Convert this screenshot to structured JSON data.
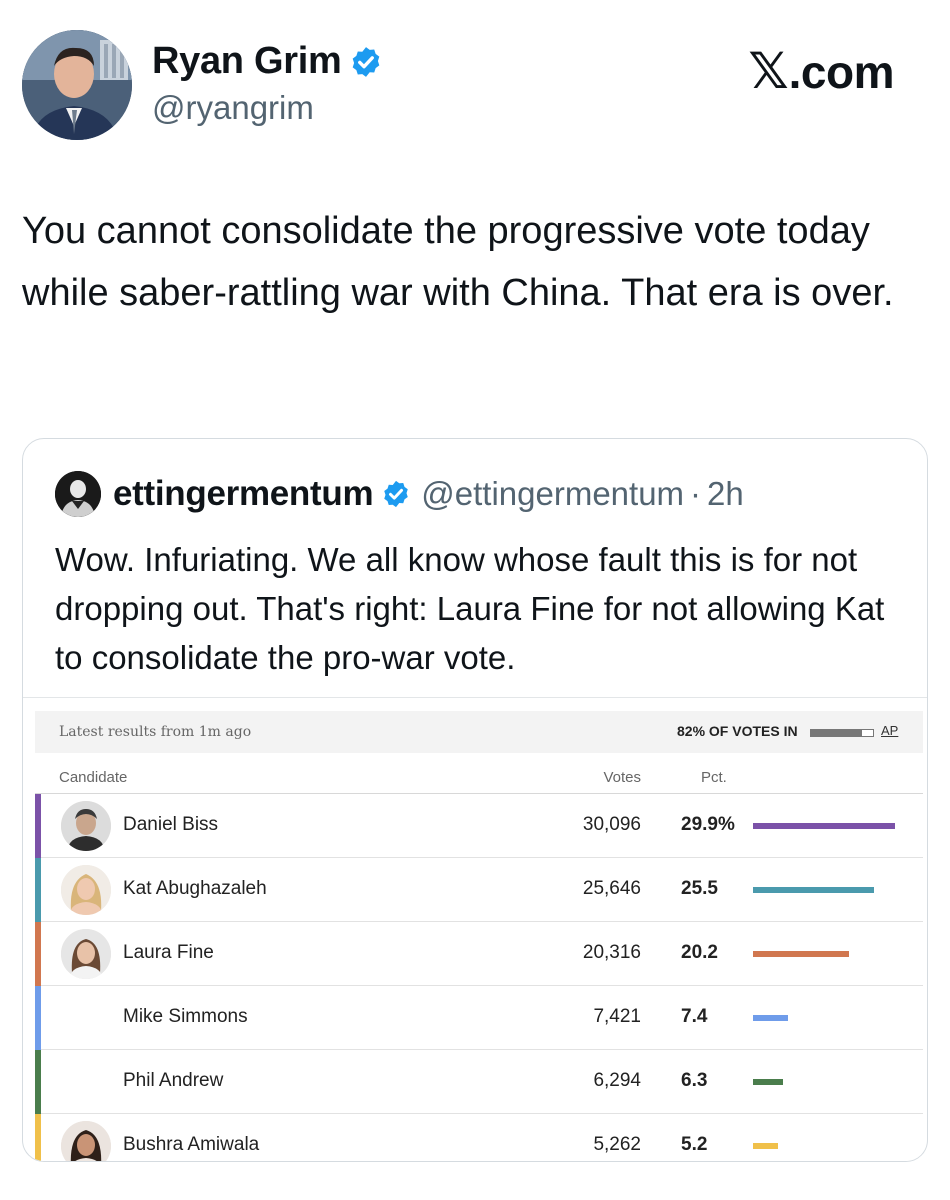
{
  "tweet": {
    "author_name": "Ryan Grim",
    "author_handle": "@ryangrim",
    "brand": {
      "x": "𝕏",
      "domain": ".com"
    },
    "text": "You cannot consolidate the progressive vote today while saber-rattling war with China. That era is over.",
    "verified_color": "#1d9bf0"
  },
  "quote": {
    "author_name": "ettingermentum",
    "author_handle": "@ettingermentum",
    "separator": "·",
    "time": "2h",
    "text": "Wow. Infuriating. We all know whose fault this is for not dropping out. That's right: Laura Fine for not allowing Kat to consolidate the pro-war vote."
  },
  "results": {
    "latest_label": "Latest results from 1m ago",
    "reporting_label": "82% OF VOTES IN",
    "reporting_fraction": 0.82,
    "source_label": "AP",
    "headers": {
      "candidate": "Candidate",
      "votes": "Votes",
      "pct": "Pct."
    },
    "max_pct": 29.9,
    "candidates": [
      {
        "name": "Daniel Biss",
        "votes": "30,096",
        "pct_label": "29.9%",
        "pct": 29.9,
        "color": "#7b52a8",
        "has_photo": true
      },
      {
        "name": "Kat Abughazaleh",
        "votes": "25,646",
        "pct_label": "25.5",
        "pct": 25.5,
        "color": "#4a9aad",
        "has_photo": true
      },
      {
        "name": "Laura Fine",
        "votes": "20,316",
        "pct_label": "20.2",
        "pct": 20.2,
        "color": "#d1774f",
        "has_photo": true
      },
      {
        "name": "Mike Simmons",
        "votes": "7,421",
        "pct_label": "7.4",
        "pct": 7.4,
        "color": "#6f9cea",
        "has_photo": false
      },
      {
        "name": "Phil Andrew",
        "votes": "6,294",
        "pct_label": "6.3",
        "pct": 6.3,
        "color": "#4a7d4c",
        "has_photo": false
      },
      {
        "name": "Bushra Amiwala",
        "votes": "5,262",
        "pct_label": "5.2",
        "pct": 5.2,
        "color": "#f0c04a",
        "has_photo": true
      }
    ]
  }
}
